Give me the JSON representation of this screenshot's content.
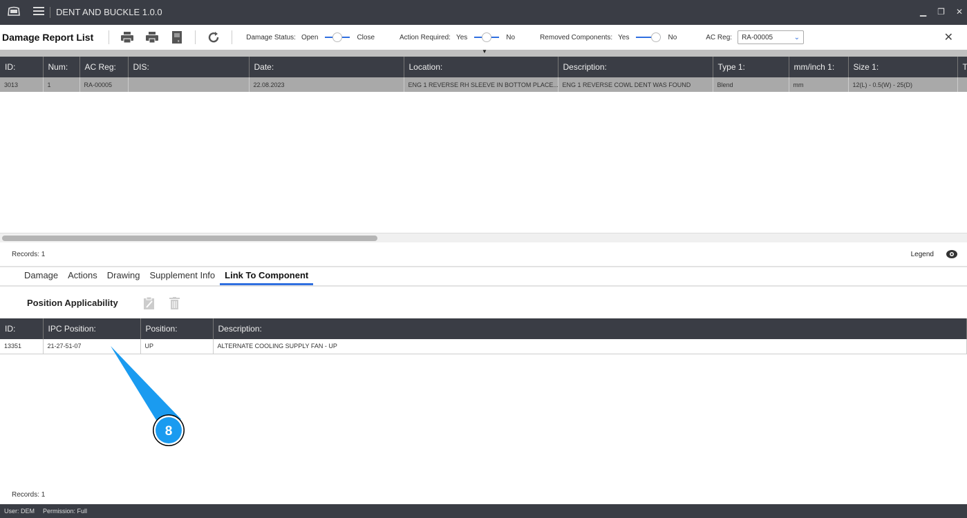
{
  "app": {
    "title": "DENT AND BUCKLE 1.0.0"
  },
  "toolbar": {
    "title": "Damage Report List",
    "damage_status": {
      "label": "Damage Status:",
      "left": "Open",
      "right": "Close"
    },
    "action_required": {
      "label": "Action Required:",
      "left": "Yes",
      "right": "No"
    },
    "removed_components": {
      "label": "Removed Components:",
      "left": "Yes",
      "right": "No"
    },
    "ac_reg": {
      "label": "AC Reg:",
      "value": "RA-00005"
    }
  },
  "reports": {
    "columns": [
      "ID:",
      "Num:",
      "AC Reg:",
      "DIS:",
      "Date:",
      "Location:",
      "Description:",
      "Type 1:",
      "mm/inch 1:",
      "Size 1:",
      "T"
    ],
    "rows": [
      [
        "3013",
        "1",
        "RA-00005",
        "",
        "22.08.2023",
        "ENG 1 REVERSE RH SLEEVE IN BOTTOM PLACE...",
        "ENG 1 REVERSE COWL DENT WAS FOUND",
        "Blend",
        "mm",
        "12(L) - 0.5(W) - 25(D)",
        ""
      ]
    ],
    "records": "Records: 1",
    "legend": "Legend"
  },
  "tabs": [
    "Damage",
    "Actions",
    "Drawing",
    "Supplement Info",
    "Link To Component"
  ],
  "active_tab": "Link To Component",
  "positions": {
    "title": "Position Applicability",
    "columns": [
      "ID:",
      "IPC Position:",
      "Position:",
      "Description:"
    ],
    "rows": [
      [
        "13351",
        "21-27-51-07",
        "UP",
        "ALTERNATE COOLING SUPPLY FAN - UP"
      ]
    ],
    "records": "Records: 1"
  },
  "callout": {
    "number": "8",
    "color": "#1a9bf0"
  },
  "status": {
    "user": "User: DEM",
    "permission": "Permission: Full"
  }
}
